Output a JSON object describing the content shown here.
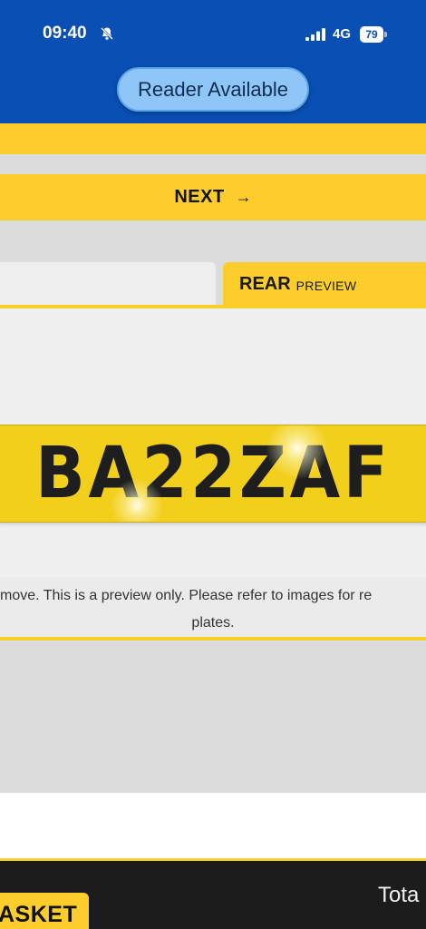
{
  "status_bar": {
    "time": "09:40",
    "network": "4G",
    "battery": "79",
    "icons": [
      "bell-off-icon",
      "signal-icon",
      "battery-icon"
    ]
  },
  "reader": {
    "label": "Reader Available"
  },
  "next_button": {
    "label": "NEXT",
    "arrow": "→"
  },
  "tabs": [
    {
      "main": "",
      "sub": ""
    },
    {
      "main": "REAR",
      "sub": "PREVIEW"
    }
  ],
  "plate": {
    "registration": "BA22ZAF"
  },
  "notice": {
    "line1": "move. This is a preview only. Please refer to images for re",
    "line2": "plates."
  },
  "footer": {
    "basket_label": "ASKET",
    "total_label": "Tota"
  },
  "colors": {
    "brand_blue": "#0a4fb4",
    "accent_yellow": "#fdcd2b",
    "plate_yellow": "#f2cf1a"
  }
}
